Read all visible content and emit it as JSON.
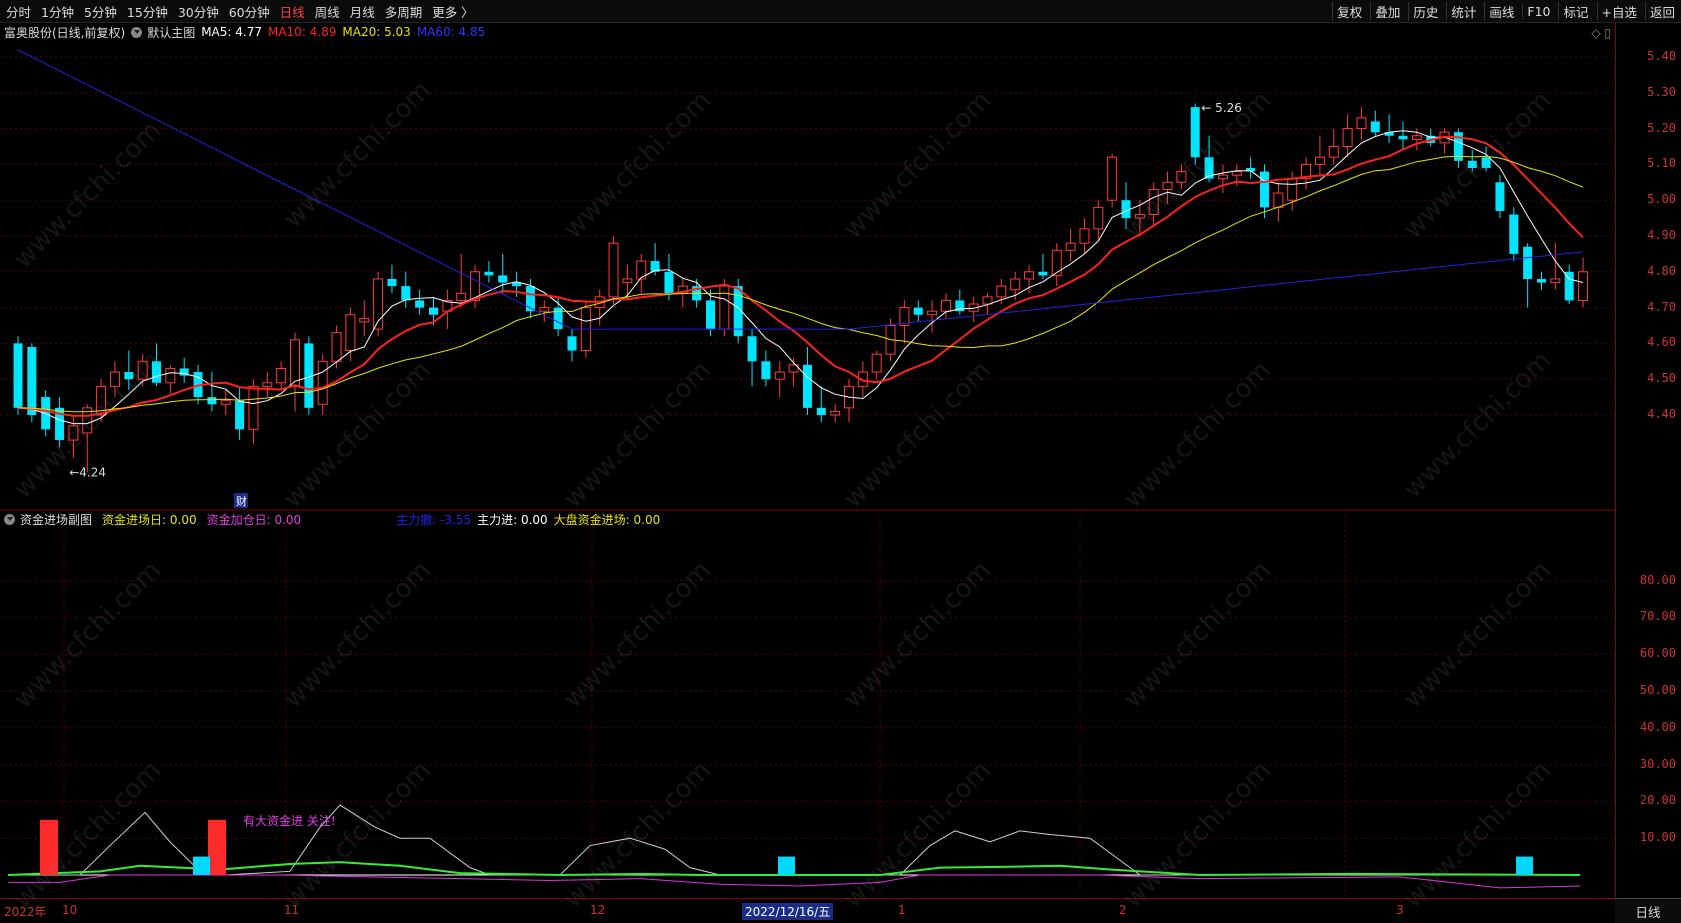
{
  "toolbar": {
    "left": [
      "分时",
      "1分钟",
      "5分钟",
      "15分钟",
      "30分钟",
      "60分钟",
      "日线",
      "周线",
      "月线",
      "多周期",
      "更多 〉"
    ],
    "active_index": 6,
    "right": [
      "复权",
      "叠加",
      "历史",
      "统计",
      "画线",
      "F10",
      "标记",
      "+自选",
      "返回"
    ]
  },
  "main_info": {
    "stock": "富奥股份(日线,前复权)",
    "indicator": "默认主图",
    "ma5": "MA5: 4.77",
    "ma10": "MA10: 4.89",
    "ma20": "MA20: 5.03",
    "ma60": "MA60: 4.85"
  },
  "sub_info": {
    "title": "资金进场副图",
    "a": "资金进场日: 0.00",
    "b": "资金加仓日: 0.00",
    "c": "主力撤: -3.55",
    "d": "主力进: 0.00",
    "e": "大盘资金进场: 0.00"
  },
  "annotations": {
    "high": "5.26",
    "low": "4.24",
    "cai": "财",
    "sub_note": "有大资金进 关注!"
  },
  "y_main": [
    "5.40",
    "5.30",
    "5.20",
    "5.10",
    "5.00",
    "4.90",
    "4.80",
    "4.70",
    "4.60",
    "4.50",
    "4.40"
  ],
  "y_sub": [
    "80.00",
    "70.00",
    "60.00",
    "50.00",
    "40.00",
    "30.00",
    "20.00",
    "10.00"
  ],
  "x_labels": [
    "2022年",
    "10",
    "11",
    "12",
    "2022/12/16/五",
    "1",
    "2",
    "3"
  ],
  "bottom_tab": "日线",
  "watermark": "www.cfchi.com",
  "colors": {
    "up": "#ff3b3b",
    "down": "#00e5ff",
    "ma5": "#ffffff",
    "ma10": "#ff2020",
    "ma20": "#e6e600",
    "ma60": "#2222dd"
  },
  "chart_data": {
    "type": "candlestick",
    "price_range": [
      4.24,
      5.26
    ],
    "candles": [
      [
        4.6,
        4.62,
        4.4,
        4.42
      ],
      [
        4.59,
        4.6,
        4.38,
        4.4
      ],
      [
        4.45,
        4.47,
        4.34,
        4.36
      ],
      [
        4.42,
        4.45,
        4.31,
        4.33
      ],
      [
        4.33,
        4.4,
        4.28,
        4.37
      ],
      [
        4.35,
        4.43,
        4.24,
        4.42
      ],
      [
        4.4,
        4.5,
        4.38,
        4.48
      ],
      [
        4.48,
        4.55,
        4.45,
        4.52
      ],
      [
        4.52,
        4.58,
        4.47,
        4.5
      ],
      [
        4.5,
        4.57,
        4.48,
        4.55
      ],
      [
        4.55,
        4.6,
        4.48,
        4.49
      ],
      [
        4.49,
        4.54,
        4.46,
        4.53
      ],
      [
        4.53,
        4.56,
        4.49,
        4.51
      ],
      [
        4.52,
        4.54,
        4.43,
        4.45
      ],
      [
        4.45,
        4.52,
        4.41,
        4.43
      ],
      [
        4.43,
        4.47,
        4.4,
        4.44
      ],
      [
        4.44,
        4.48,
        4.33,
        4.36
      ],
      [
        4.36,
        4.5,
        4.32,
        4.48
      ],
      [
        4.48,
        4.52,
        4.45,
        4.49
      ],
      [
        4.49,
        4.55,
        4.47,
        4.53
      ],
      [
        4.48,
        4.63,
        4.41,
        4.61
      ],
      [
        4.6,
        4.62,
        4.4,
        4.42
      ],
      [
        4.43,
        4.57,
        4.4,
        4.55
      ],
      [
        4.55,
        4.65,
        4.53,
        4.63
      ],
      [
        4.58,
        4.7,
        4.55,
        4.68
      ],
      [
        4.66,
        4.72,
        4.62,
        4.67
      ],
      [
        4.64,
        4.8,
        4.62,
        4.78
      ],
      [
        4.78,
        4.82,
        4.74,
        4.76
      ],
      [
        4.76,
        4.8,
        4.7,
        4.72
      ],
      [
        4.72,
        4.75,
        4.68,
        4.7
      ],
      [
        4.7,
        4.73,
        4.65,
        4.68
      ],
      [
        4.69,
        4.75,
        4.64,
        4.72
      ],
      [
        4.72,
        4.85,
        4.7,
        4.74
      ],
      [
        4.72,
        4.82,
        4.7,
        4.8
      ],
      [
        4.8,
        4.83,
        4.77,
        4.79
      ],
      [
        4.79,
        4.85,
        4.74,
        4.77
      ],
      [
        4.77,
        4.8,
        4.73,
        4.76
      ],
      [
        4.76,
        4.78,
        4.67,
        4.69
      ],
      [
        4.69,
        4.72,
        4.66,
        4.7
      ],
      [
        4.7,
        4.73,
        4.62,
        4.64
      ],
      [
        4.62,
        4.64,
        4.55,
        4.58
      ],
      [
        4.58,
        4.72,
        4.56,
        4.7
      ],
      [
        4.7,
        4.75,
        4.65,
        4.73
      ],
      [
        4.73,
        4.9,
        4.71,
        4.88
      ],
      [
        4.77,
        4.82,
        4.72,
        4.78
      ],
      [
        4.78,
        4.85,
        4.74,
        4.83
      ],
      [
        4.83,
        4.88,
        4.79,
        4.8
      ],
      [
        4.8,
        4.85,
        4.72,
        4.74
      ],
      [
        4.74,
        4.78,
        4.7,
        4.76
      ],
      [
        4.76,
        4.78,
        4.7,
        4.72
      ],
      [
        4.72,
        4.75,
        4.62,
        4.64
      ],
      [
        4.64,
        4.78,
        4.62,
        4.76
      ],
      [
        4.76,
        4.78,
        4.6,
        4.62
      ],
      [
        4.62,
        4.64,
        4.48,
        4.55
      ],
      [
        4.55,
        4.58,
        4.48,
        4.5
      ],
      [
        4.5,
        4.55,
        4.45,
        4.52
      ],
      [
        4.52,
        4.56,
        4.48,
        4.54
      ],
      [
        4.54,
        4.59,
        4.4,
        4.42
      ],
      [
        4.42,
        4.48,
        4.38,
        4.4
      ],
      [
        4.4,
        4.43,
        4.38,
        4.41
      ],
      [
        4.42,
        4.5,
        4.38,
        4.48
      ],
      [
        4.48,
        4.55,
        4.45,
        4.52
      ],
      [
        4.52,
        4.58,
        4.5,
        4.57
      ],
      [
        4.57,
        4.67,
        4.55,
        4.65
      ],
      [
        4.65,
        4.72,
        4.6,
        4.7
      ],
      [
        4.7,
        4.72,
        4.66,
        4.68
      ],
      [
        4.68,
        4.72,
        4.63,
        4.69
      ],
      [
        4.69,
        4.74,
        4.67,
        4.72
      ],
      [
        4.72,
        4.75,
        4.68,
        4.69
      ],
      [
        4.69,
        4.73,
        4.66,
        4.71
      ],
      [
        4.71,
        4.74,
        4.68,
        4.73
      ],
      [
        4.73,
        4.78,
        4.71,
        4.76
      ],
      [
        4.75,
        4.8,
        4.72,
        4.78
      ],
      [
        4.78,
        4.82,
        4.74,
        4.8
      ],
      [
        4.8,
        4.85,
        4.78,
        4.79
      ],
      [
        4.79,
        4.88,
        4.76,
        4.86
      ],
      [
        4.86,
        4.92,
        4.83,
        4.88
      ],
      [
        4.88,
        4.95,
        4.85,
        4.92
      ],
      [
        4.92,
        5.0,
        4.89,
        4.98
      ],
      [
        5.0,
        5.13,
        4.98,
        5.12
      ],
      [
        5.0,
        5.05,
        4.92,
        4.95
      ],
      [
        4.95,
        5.0,
        4.9,
        4.96
      ],
      [
        4.96,
        5.05,
        4.93,
        5.03
      ],
      [
        5.03,
        5.08,
        4.99,
        5.05
      ],
      [
        5.05,
        5.1,
        5.03,
        5.08
      ],
      [
        5.26,
        5.27,
        5.1,
        5.12
      ],
      [
        5.12,
        5.18,
        5.05,
        5.06
      ],
      [
        5.06,
        5.1,
        5.02,
        5.07
      ],
      [
        5.07,
        5.1,
        5.04,
        5.08
      ],
      [
        5.09,
        5.12,
        5.06,
        5.08
      ],
      [
        5.08,
        5.1,
        4.95,
        4.98
      ],
      [
        4.98,
        5.05,
        4.94,
        5.02
      ],
      [
        5.0,
        5.08,
        4.97,
        5.06
      ],
      [
        5.06,
        5.12,
        5.03,
        5.1
      ],
      [
        5.1,
        5.18,
        5.07,
        5.12
      ],
      [
        5.12,
        5.2,
        5.1,
        5.15
      ],
      [
        5.15,
        5.24,
        5.12,
        5.2
      ],
      [
        5.2,
        5.26,
        5.17,
        5.23
      ],
      [
        5.22,
        5.25,
        5.18,
        5.19
      ],
      [
        5.19,
        5.24,
        5.16,
        5.18
      ],
      [
        5.18,
        5.22,
        5.14,
        5.17
      ],
      [
        5.17,
        5.2,
        5.14,
        5.18
      ],
      [
        5.18,
        5.2,
        5.15,
        5.16
      ],
      [
        5.16,
        5.2,
        5.13,
        5.19
      ],
      [
        5.19,
        5.2,
        5.09,
        5.11
      ],
      [
        5.11,
        5.14,
        5.08,
        5.09
      ],
      [
        5.12,
        5.15,
        5.08,
        5.09
      ],
      [
        5.05,
        5.07,
        4.95,
        4.97
      ],
      [
        4.96,
        4.98,
        4.83,
        4.85
      ],
      [
        4.87,
        4.88,
        4.7,
        4.78
      ],
      [
        4.78,
        4.8,
        4.75,
        4.77
      ],
      [
        4.77,
        4.88,
        4.75,
        4.78
      ],
      [
        4.8,
        4.82,
        4.71,
        4.72
      ],
      [
        4.72,
        4.84,
        4.7,
        4.8
      ]
    ]
  }
}
